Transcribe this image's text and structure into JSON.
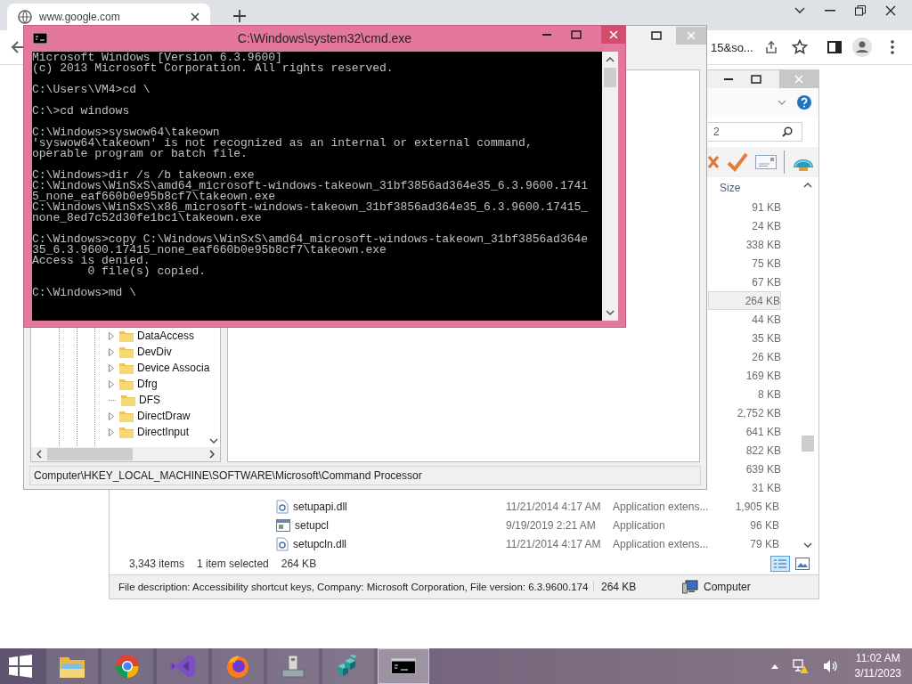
{
  "chrome": {
    "tab_title": "www.google.com",
    "omnibox_text": "15&so..."
  },
  "explorer": {
    "search_value": "2",
    "size_header": "Size",
    "files": [
      {
        "size": "91 KB",
        "selected": false
      },
      {
        "size": "24 KB",
        "selected": false
      },
      {
        "size": "338 KB",
        "selected": false
      },
      {
        "size": "75 KB",
        "selected": false
      },
      {
        "size": "67 KB",
        "selected": false
      },
      {
        "size": "264 KB",
        "selected": true
      },
      {
        "size": "44 KB",
        "selected": false
      },
      {
        "size": "35 KB",
        "selected": false
      },
      {
        "size": "26 KB",
        "selected": false
      },
      {
        "size": "169 KB",
        "selected": false
      },
      {
        "size": "8 KB",
        "selected": false
      },
      {
        "size": "2,752 KB",
        "selected": false
      },
      {
        "size": "641 KB",
        "selected": false
      },
      {
        "size": "822 KB",
        "selected": false
      },
      {
        "size": "639 KB",
        "selected": false
      },
      {
        "size": "31 KB",
        "selected": false
      },
      {
        "kind": "extension",
        "name": "setupapi.dll",
        "date": "11/21/2014 4:17 AM",
        "type": "Application extens...",
        "size": "1,905 KB",
        "selected": false
      },
      {
        "kind": "application",
        "name": "setupcl",
        "date": "9/19/2019 2:21 AM",
        "type": "Application",
        "size": "96 KB",
        "selected": false
      },
      {
        "kind": "extension",
        "name": "setupcln.dll",
        "date": "11/21/2014 4:17 AM",
        "type": "Application extens...",
        "size": "79 KB",
        "selected": false
      }
    ],
    "item_count": "3,343 items",
    "selection": "1 item selected",
    "selection_size": "264 KB",
    "details": {
      "description": "File description: Accessibility shortcut keys, Company: Microsoft Corporation, File version: 6.3.9600.174",
      "size": "264 KB",
      "location": "Computer"
    }
  },
  "registry": {
    "tree": [
      {
        "label": "DataAccess",
        "expandable": true
      },
      {
        "label": "DevDiv",
        "expandable": true
      },
      {
        "label": "Device Associa",
        "expandable": true
      },
      {
        "label": "Dfrg",
        "expandable": true
      },
      {
        "label": "DFS",
        "expandable": false
      },
      {
        "label": "DirectDraw",
        "expandable": true
      },
      {
        "label": "DirectInput",
        "expandable": true
      }
    ],
    "path": "Computer\\HKEY_LOCAL_MACHINE\\SOFTWARE\\Microsoft\\Command Processor"
  },
  "cmd": {
    "title": "C:\\Windows\\system32\\cmd.exe",
    "blocks": [
      [
        "Microsoft Windows [Version 6.3.9600]",
        "(c) 2013 Microsoft Corporation. All rights reserved."
      ],
      [
        "C:\\Users\\VM4>cd \\"
      ],
      [
        "C:\\>cd windows"
      ],
      [
        "C:\\Windows>syswow64\\takeown",
        "'syswow64\\takeown' is not recognized as an internal or external command,",
        "operable program or batch file."
      ],
      [
        "C:\\Windows>dir /s /b takeown.exe",
        "C:\\Windows\\WinSxS\\amd64_microsoft-windows-takeown_31bf3856ad364e35_6.3.9600.1741",
        "5_none_eaf660b0e95b8cf7\\takeown.exe",
        "C:\\Windows\\WinSxS\\x86_microsoft-windows-takeown_31bf3856ad364e35_6.3.9600.17415_",
        "none_8ed7c52d30fe1bc1\\takeown.exe"
      ],
      [
        "C:\\Windows>copy C:\\Windows\\WinSxS\\amd64_microsoft-windows-takeown_31bf3856ad364e",
        "35_6.3.9600.17415_none_eaf660b0e95b8cf7\\takeown.exe",
        "Access is denied.",
        "        0 file(s) copied."
      ],
      [
        "C:\\Windows>md \\"
      ]
    ]
  },
  "taskbar": {
    "apps": [
      {
        "kind": "explorer",
        "selected": false
      },
      {
        "kind": "browser",
        "selected": false
      },
      {
        "kind": "studio",
        "selected": false
      },
      {
        "kind": "firefox",
        "selected": false
      },
      {
        "kind": "device",
        "selected": false
      },
      {
        "kind": "registry",
        "selected": false
      },
      {
        "kind": "console",
        "selected": true
      }
    ],
    "time": "11:02 AM",
    "date": "3/11/2023"
  }
}
